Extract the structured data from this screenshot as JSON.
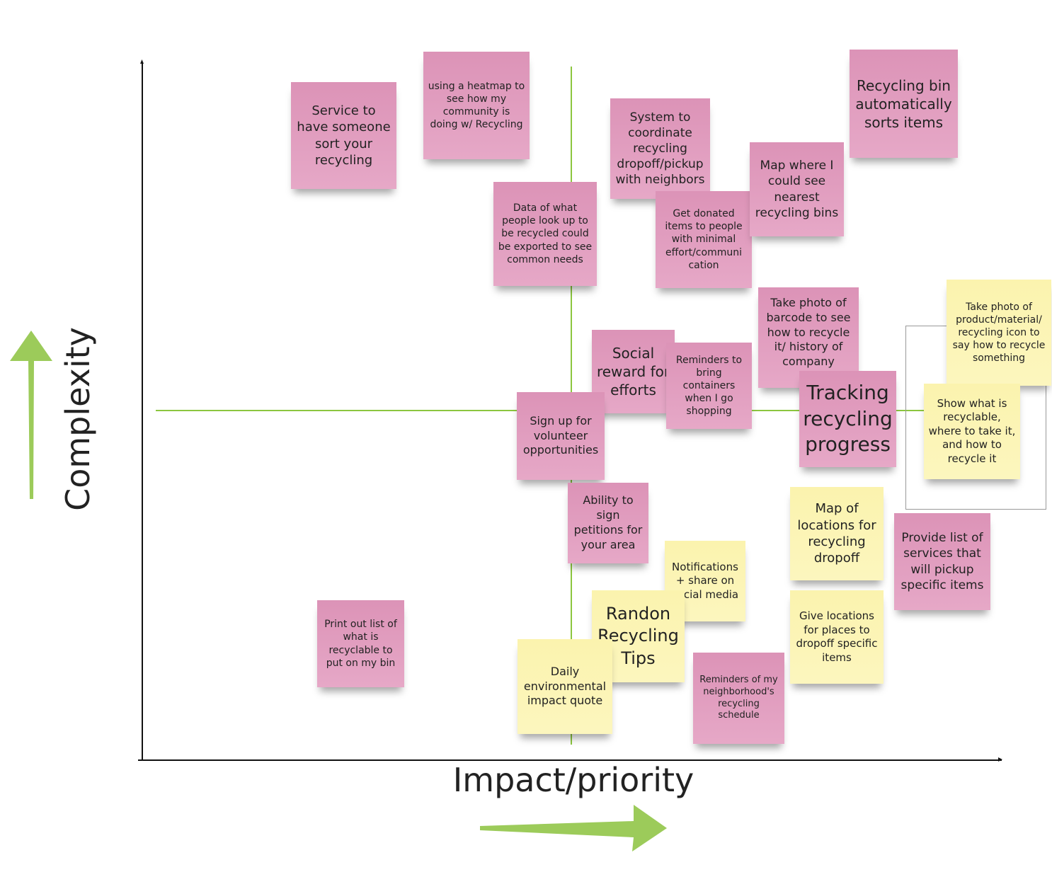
{
  "axes": {
    "y_label": "Complexity",
    "x_label": "Impact/priority",
    "arrow_color": "#9ccb5a",
    "divider_color": "#8cc63f"
  },
  "colors": {
    "pink": "#df99bb",
    "yellow": "#fbf4b4"
  },
  "notes": [
    {
      "text": "Service to have someone sort your recycling",
      "color": "pink"
    },
    {
      "text": "using a heatmap to see how my community is doing w/ Recycling",
      "color": "pink"
    },
    {
      "text": "Data of what people look up to be recycled could be exported to see common needs",
      "color": "pink"
    },
    {
      "text": "System to coordinate recycling dropoff/pickup with neighbors",
      "color": "pink"
    },
    {
      "text": "Get donated items to people with minimal effort/communi cation",
      "color": "pink"
    },
    {
      "text": "Map where I could see nearest recycling bins",
      "color": "pink"
    },
    {
      "text": "Recycling bin automatically sorts items",
      "color": "pink"
    },
    {
      "text": "Take photo of barcode to see how to recycle it/ history of company",
      "color": "pink"
    },
    {
      "text": "Take photo of product/material/ recycling icon to say how to recycle something",
      "color": "yellow"
    },
    {
      "text": "Social reward for efforts",
      "color": "pink"
    },
    {
      "text": "Reminders to bring containers when I go shopping",
      "color": "pink"
    },
    {
      "text": "Tracking recycling progress",
      "color": "pink"
    },
    {
      "text": "Show what is recyclable, where to take it, and how to recycle it",
      "color": "yellow"
    },
    {
      "text": "Sign up for volunteer opportunities",
      "color": "pink"
    },
    {
      "text": "Ability to sign petitions for your area",
      "color": "pink"
    },
    {
      "text": "Map of locations for recycling dropoff",
      "color": "yellow"
    },
    {
      "text": "Provide list of services that will pickup specific items",
      "color": "pink"
    },
    {
      "text": "Notifications + share on social media",
      "color": "yellow"
    },
    {
      "text": "Print out list of what is recyclable to put on my bin",
      "color": "pink"
    },
    {
      "text": "Randon Recycling Tips",
      "color": "yellow"
    },
    {
      "text": "Give locations for places to dropoff specific items",
      "color": "yellow"
    },
    {
      "text": "Daily environmental impact quote",
      "color": "yellow"
    },
    {
      "text": "Reminders of my neighborhood's recycling schedule",
      "color": "pink"
    }
  ]
}
